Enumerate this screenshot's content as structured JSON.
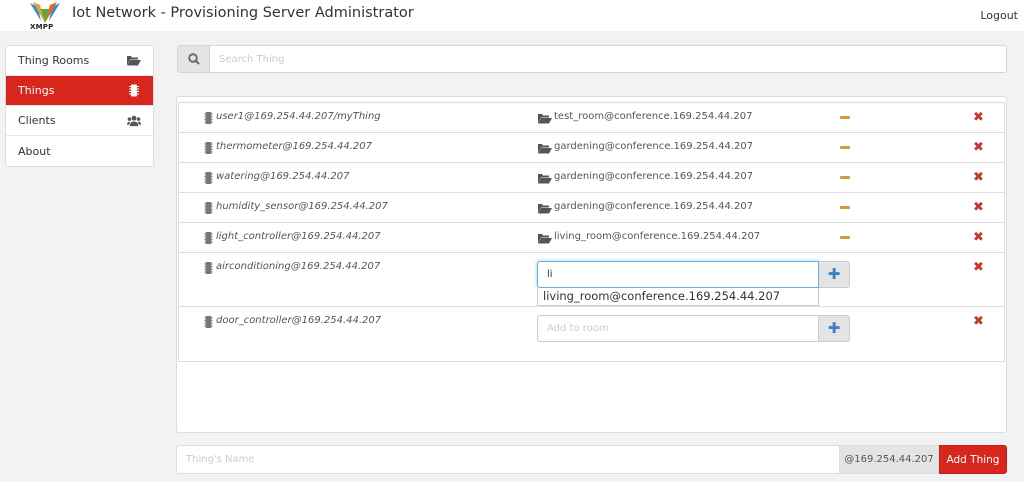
{
  "header": {
    "logo_text": "XMPP",
    "title": "Iot Network - Provisioning Server Administrator",
    "logout_label": "Logout"
  },
  "sidebar": {
    "items": [
      {
        "label": "Thing Rooms",
        "icon": "folder-open-icon",
        "active": false
      },
      {
        "label": "Things",
        "icon": "chip-icon",
        "active": true
      },
      {
        "label": "Clients",
        "icon": "users-icon",
        "active": false
      },
      {
        "label": "About",
        "icon": "",
        "active": false
      }
    ]
  },
  "search": {
    "placeholder": "Search Thing",
    "icon": "search-icon"
  },
  "things": [
    {
      "name": "user1@169.254.44.207/myThing",
      "room": "test_room@conference.169.254.44.207"
    },
    {
      "name": "thermometer@169.254.44.207",
      "room": "gardening@conference.169.254.44.207"
    },
    {
      "name": "watering@169.254.44.207",
      "room": "gardening@conference.169.254.44.207"
    },
    {
      "name": "humidity_sensor@169.254.44.207",
      "room": "gardening@conference.169.254.44.207"
    },
    {
      "name": "light_controller@169.254.44.207",
      "room": "living_room@conference.169.254.44.207"
    },
    {
      "name": "airconditioning@169.254.44.207",
      "room_input_value": "li",
      "suggestion": "living_room@conference.169.254.44.207"
    },
    {
      "name": "door_controller@169.254.44.207",
      "room_input_placeholder": "Add to room"
    }
  ],
  "add_thing": {
    "name_placeholder": "Thing's Name",
    "domain": "@169.254.44.207",
    "button_label": "Add Thing"
  },
  "colors": {
    "accent": "#d9261c",
    "remove": "#c0392b",
    "minus": "#d39a3a",
    "plus": "#3f7fbf"
  }
}
